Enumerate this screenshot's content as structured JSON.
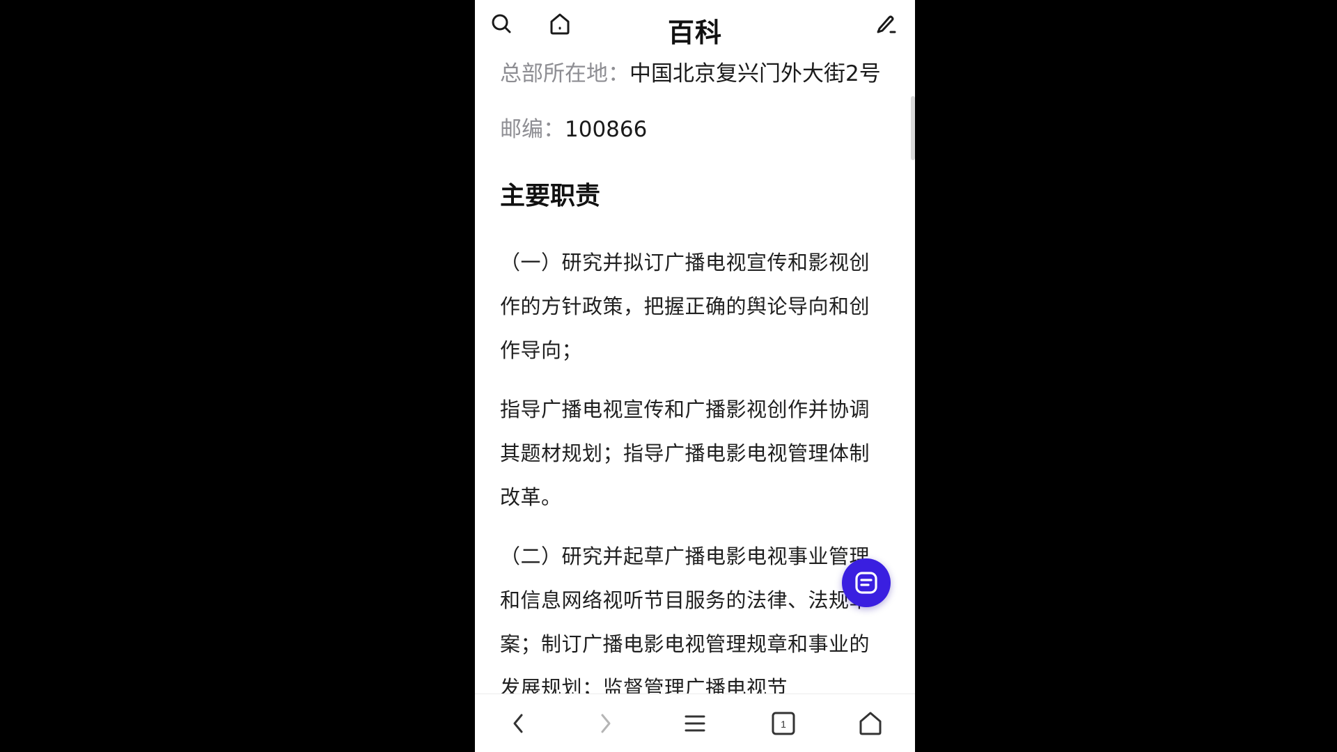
{
  "header": {
    "title": "百科",
    "icons": [
      "search-icon",
      "home-icon",
      "edit-icon"
    ]
  },
  "info": {
    "hq_label": "总部所在地：",
    "hq_value": "中国北京复兴门外大街2号",
    "postcode_label": "邮编：",
    "postcode_value": "100866"
  },
  "section": {
    "heading": "主要职责",
    "paragraphs": [
      "（一）研究并拟订广播电视宣传和影视创作的方针政策，把握正确的舆论导向和创作导向；",
      "指导广播电视宣传和广播影视创作并协调其题材规划；指导广播电影电视管理体制改革。",
      "（二）研究并起草广播电影电视事业管理和信息网络视听节目服务的法律、法规草案；制订广播电影电视管理规章和事业的发展规划；监督管理广播电视节"
    ]
  },
  "bottom_nav": {
    "tab_count": "1",
    "icons": [
      "back-icon",
      "forward-icon",
      "menu-icon",
      "tabs-icon",
      "home-icon"
    ]
  },
  "colors": {
    "fab": "#3a1fe0",
    "label_gray": "#8e8e93",
    "text": "#1f1f1f",
    "background": "#000000"
  }
}
